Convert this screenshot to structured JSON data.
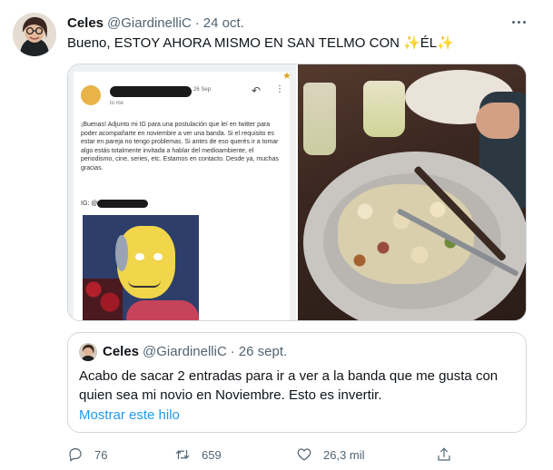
{
  "tweet": {
    "author_name": "Celes",
    "author_handle": "@GiardinelliC",
    "separator": "·",
    "date": "24 oct.",
    "text": "Bueno, ESTOY AHORA MISMO EN SAN TELMO CON ✨ÉL✨"
  },
  "media": {
    "screenshot": {
      "date": "26 Sep",
      "to_me": "to me",
      "body": "¡Buenas! Adjunto mi IG para una postulación que leí en twitter para poder acompañarte en noviembre a ver una banda. Si el requisito es estar en pareja no tengo problemas. Si antes de eso querés ir a tomar algo estás totalmente invitada a hablar del medioambiente, el periodismo, cine, series, etc. Estamos en contacto. Desde ya, muchas gracias.",
      "ig_label": "IG: @"
    }
  },
  "quote": {
    "author_name": "Celes",
    "author_handle": "@GiardinelliC",
    "separator": "·",
    "date": "26 sept.",
    "text": "Acabo de sacar 2 entradas para ir a ver a la banda que me gusta con quien sea mi novio en Noviembre. Esto es invertir.",
    "show_thread": "Mostrar este hilo"
  },
  "actions": {
    "replies": "76",
    "retweets": "659",
    "likes": "26,3 mil"
  },
  "colors": {
    "link": "#1d9bf0",
    "secondary_text": "#536471",
    "border": "#cfd9de"
  },
  "icons": [
    "more-icon",
    "reply-icon",
    "retweet-icon",
    "like-icon",
    "share-icon"
  ]
}
